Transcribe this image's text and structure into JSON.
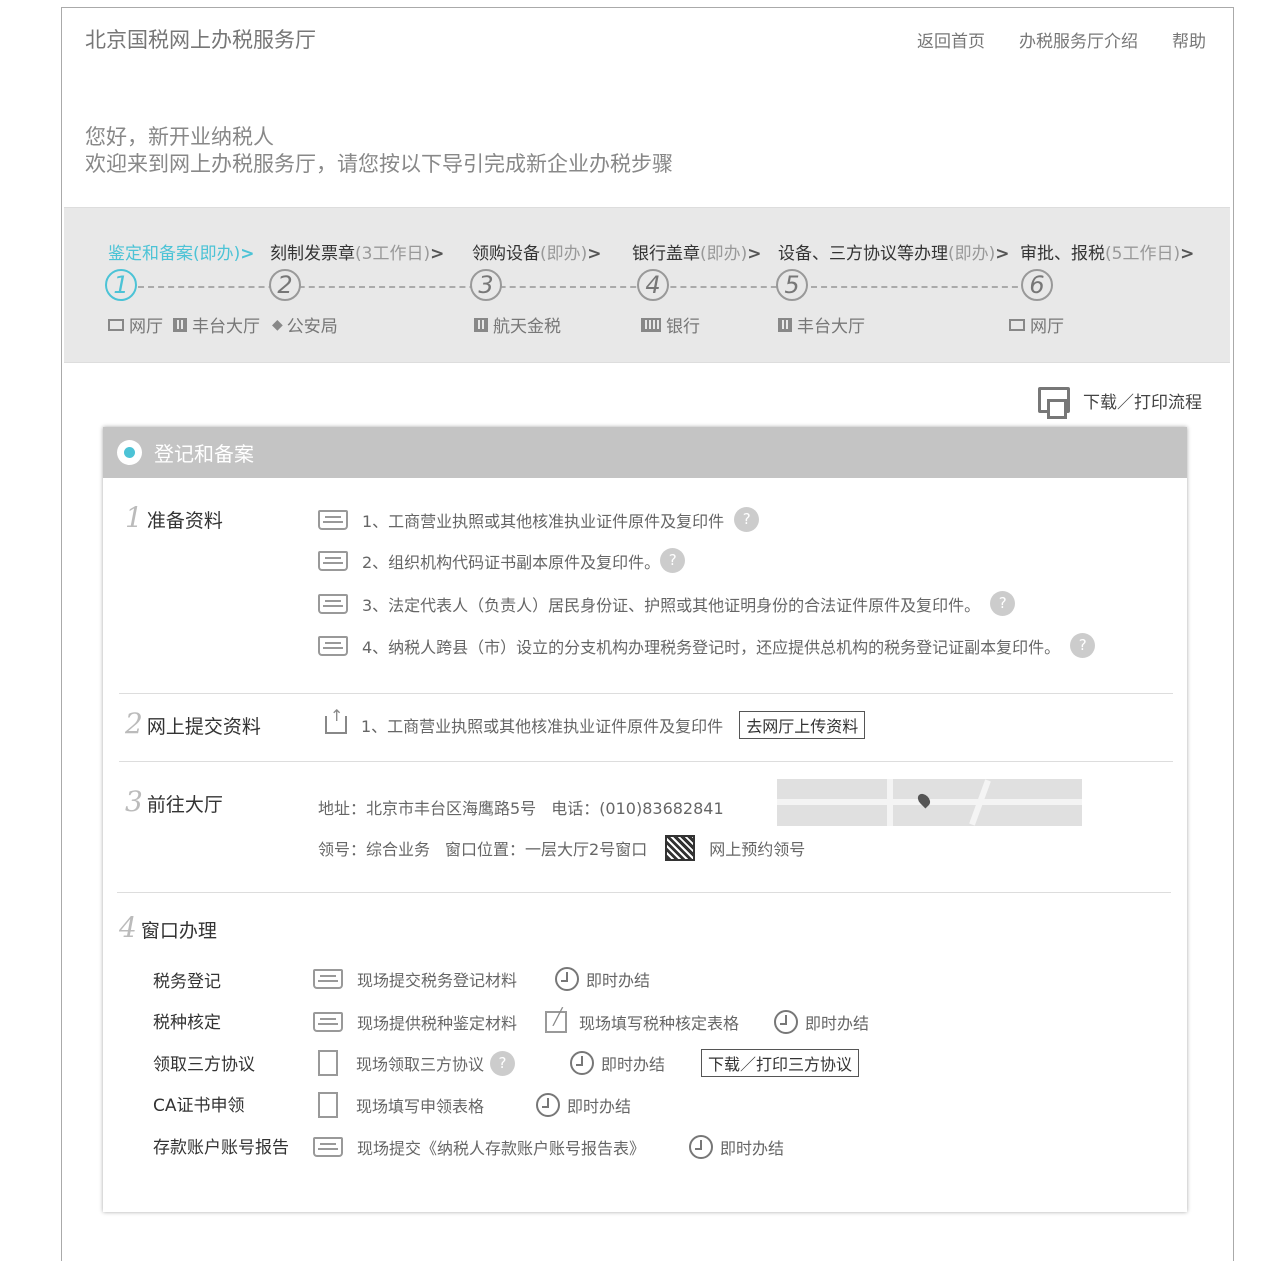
{
  "header": {
    "title": "北京国税网上办税服务厅",
    "links": [
      "返回首页",
      "办税服务厅介绍",
      "帮助"
    ]
  },
  "greeting": {
    "line1": "您好，新开业纳税人",
    "line2": "欢迎来到网上办税服务厅，请您按以下导引完成新企业办税步骤"
  },
  "steps": [
    {
      "num": "1",
      "name": "鉴定和备案",
      "duration": "(即办)",
      "arrow": ">",
      "locations": [
        "网厅",
        "丰台大厅"
      ],
      "active": true
    },
    {
      "num": "2",
      "name": "刻制发票章",
      "duration": "(3工作日)",
      "arrow": ">",
      "locations": [
        "公安局"
      ]
    },
    {
      "num": "3",
      "name": "领购设备",
      "duration": "(即办)",
      "arrow": ">",
      "locations": [
        "航天金税"
      ]
    },
    {
      "num": "4",
      "name": "银行盖章",
      "duration": "(即办)",
      "arrow": ">",
      "locations": [
        "银行"
      ]
    },
    {
      "num": "5",
      "name": "设备、三方协议等办理",
      "duration": "(即办)",
      "arrow": ">",
      "locations": [
        "丰台大厅"
      ]
    },
    {
      "num": "6",
      "name": "审批、报税",
      "duration": "(5工作日)",
      "arrow": ">",
      "locations": [
        "网厅"
      ]
    }
  ],
  "download_flow": "下载／打印流程",
  "card": {
    "title": "登记和备案",
    "sections": [
      {
        "num": "1",
        "title": "准备资料",
        "items": [
          "1、工商营业执照或其他核准执业证件原件及复印件",
          "2、组织机构代码证书副本原件及复印件。",
          "3、法定代表人（负责人）居民身份证、护照或其他证明身份的合法证件原件及复印件。",
          "4、纳税人跨县（市）设立的分支机构办理税务登记时，还应提供总机构的税务登记证副本复印件。"
        ]
      },
      {
        "num": "2",
        "title": "网上提交资料",
        "item": "1、工商营业执照或其他核准执业证件原件及复印件",
        "button": "去网厅上传资料"
      },
      {
        "num": "3",
        "title": "前往大厅",
        "address": "地址：北京市丰台区海鹰路5号",
        "phone": "电话：(010)83682841",
        "ticket": "领号：综合业务",
        "window": "窗口位置：一层大厅2号窗口",
        "appointment": "网上预约领号"
      },
      {
        "num": "4",
        "title": "窗口办理",
        "rows": [
          {
            "label": "税务登记",
            "action1": "现场提交税务登记材料",
            "status": "即时办结"
          },
          {
            "label": "税种核定",
            "action1": "现场提供税种鉴定材料",
            "action2": "现场填写税种核定表格",
            "status": "即时办结"
          },
          {
            "label": "领取三方协议",
            "action1": "现场领取三方协议",
            "status": "即时办结",
            "button": "下载／打印三方协议"
          },
          {
            "label": "CA证书申领",
            "action1": "现场填写申领表格",
            "status": "即时办结"
          },
          {
            "label": "存款账户账号报告",
            "action1": "现场提交《纳税人存款账户账号报告表》",
            "status": "即时办结"
          }
        ]
      }
    ]
  },
  "help_mark": "?",
  "colors": {
    "accent": "#4cc3d6",
    "step_bg": "#e8e8e8",
    "card_head": "#c4c4c4"
  }
}
